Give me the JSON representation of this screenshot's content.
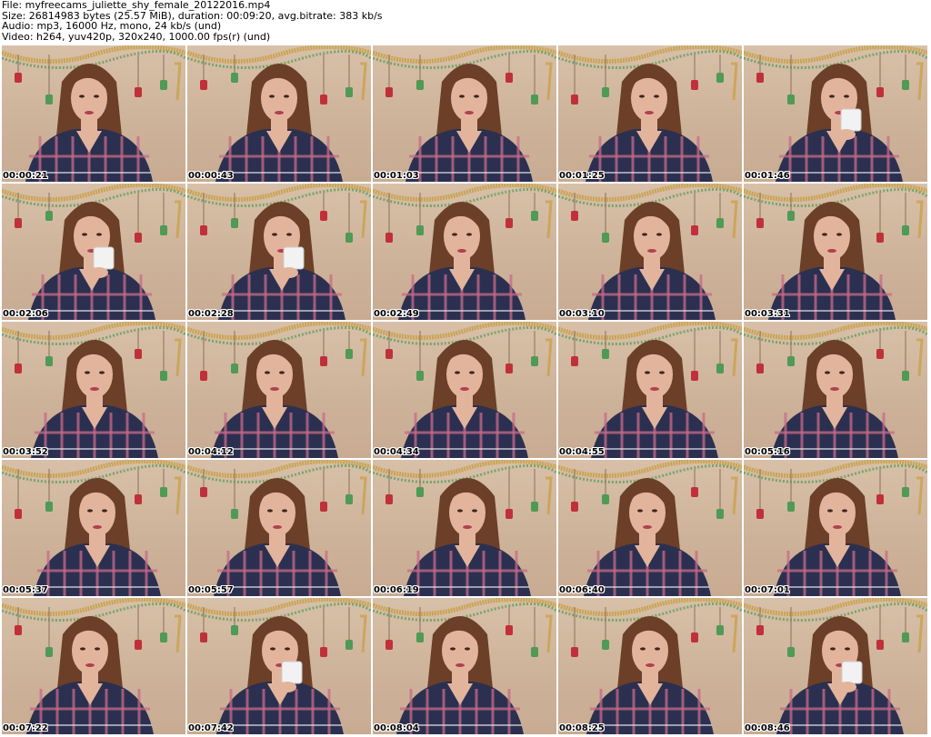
{
  "header": {
    "file": "File: myfreecams_juliette_shy_female_20122016.mp4",
    "size": "Size: 26814983 bytes (25.57 MiB), duration: 00:09:20, avg.bitrate: 383 kb/s",
    "audio": "Audio: mp3, 16000 Hz, mono, 24 kb/s (und)",
    "video": "Video: h264, yuv420p, 320x240, 1000.00 fps(r) (und)"
  },
  "frames": [
    {
      "timestamp": "00:00:21"
    },
    {
      "timestamp": "00:00:43"
    },
    {
      "timestamp": "00:01:03"
    },
    {
      "timestamp": "00:01:25"
    },
    {
      "timestamp": "00:01:46"
    },
    {
      "timestamp": "00:02:06"
    },
    {
      "timestamp": "00:02:28"
    },
    {
      "timestamp": "00:02:49"
    },
    {
      "timestamp": "00:03:10"
    },
    {
      "timestamp": "00:03:31"
    },
    {
      "timestamp": "00:03:52"
    },
    {
      "timestamp": "00:04:12"
    },
    {
      "timestamp": "00:04:34"
    },
    {
      "timestamp": "00:04:55"
    },
    {
      "timestamp": "00:05:16"
    },
    {
      "timestamp": "00:05:37"
    },
    {
      "timestamp": "00:05:57"
    },
    {
      "timestamp": "00:06:19"
    },
    {
      "timestamp": "00:06:40"
    },
    {
      "timestamp": "00:07:01"
    },
    {
      "timestamp": "00:07:22"
    },
    {
      "timestamp": "00:07:42"
    },
    {
      "timestamp": "00:08:04"
    },
    {
      "timestamp": "00:08:25"
    },
    {
      "timestamp": "00:08:46"
    }
  ],
  "colors": {
    "wall": "#d3b9a0",
    "hair": "#6b3f28",
    "skin": "#e3b49c",
    "shirt_dark": "#2c3050",
    "shirt_pink": "#c86a88",
    "tinsel_gold": "#c9a14a",
    "tinsel_green": "#4f9a55",
    "ornament_red": "#c0303a"
  }
}
